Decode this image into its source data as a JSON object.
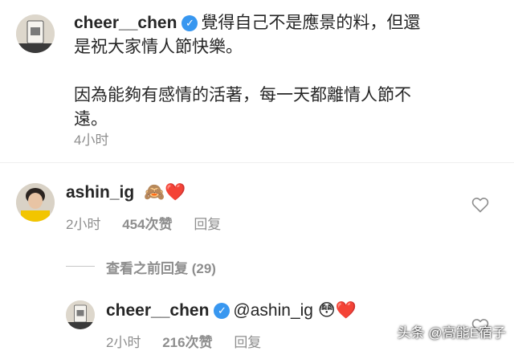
{
  "post": {
    "username": "cheer__chen",
    "verified_icon": "verified-badge-icon",
    "caption_line1": "覺得自己不是應景的料，但還",
    "caption_line2": "是祝大家情人節快樂。",
    "caption_line3": "因為能夠有感情的活著，每一天都離情人節不",
    "caption_line4": "遠。",
    "time": "4小时"
  },
  "comment": {
    "username": "ashin_ig",
    "emoji_monkey": "🙈",
    "emoji_heart": "❤️",
    "time": "2小时",
    "likes": "454次赞",
    "reply": "回复",
    "view_replies": "查看之前回复 (29)"
  },
  "reply": {
    "username": "cheer__chen",
    "mention": "@ashin_ig",
    "emoji_flushed": "😳",
    "emoji_heart": "❤️",
    "time": "2小时",
    "likes": "216次赞",
    "reply": "回复"
  },
  "watermark": "头条 @高能E宿子",
  "colors": {
    "text": "#262626",
    "meta": "#8e8e8e",
    "verified": "#3897f0",
    "heart": "#ed4956"
  }
}
